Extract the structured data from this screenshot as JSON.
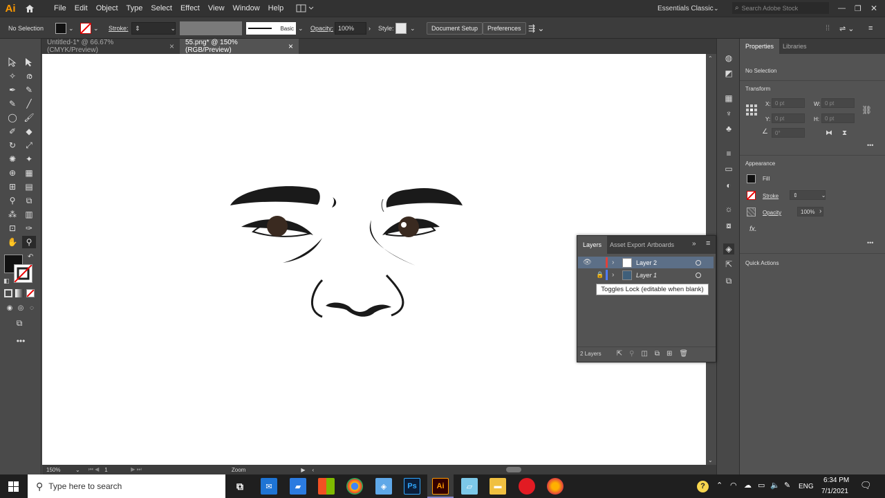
{
  "app": {
    "logo": "Ai"
  },
  "menu": [
    "File",
    "Edit",
    "Object",
    "Type",
    "Select",
    "Effect",
    "View",
    "Window",
    "Help"
  ],
  "workspace": "Essentials Classic",
  "search_placeholder": "Search Adobe Stock",
  "control": {
    "selection": "No Selection",
    "stroke_label": "Stroke:",
    "brush": "Basic",
    "opacity_label": "Opacity:",
    "opacity_value": "100%",
    "style_label": "Style:",
    "doc_setup": "Document Setup",
    "preferences": "Preferences"
  },
  "tabs": [
    {
      "label": "Untitled-1* @ 66.67% (CMYK/Preview)",
      "close": "×"
    },
    {
      "label": "55.png* @ 150% (RGB/Preview)",
      "close": "×"
    }
  ],
  "status": {
    "zoom": "150%",
    "page": "1",
    "tool": "Zoom"
  },
  "properties": {
    "tabs": [
      "Properties",
      "Libraries"
    ],
    "selection": "No Selection",
    "transform": "Transform",
    "x_label": "X:",
    "y_label": "Y:",
    "w_label": "W:",
    "h_label": "H:",
    "pt": "0 pt",
    "angle": "0°",
    "appearance": "Appearance",
    "fill": "Fill",
    "stroke": "Stroke",
    "opacity": "Opacity",
    "opacity_value": "100%",
    "fx": "fx.",
    "quick_actions": "Quick Actions",
    "more": "•••"
  },
  "layers_panel": {
    "tabs": [
      "Layers",
      "Asset Export",
      "Artboards"
    ],
    "layers": [
      {
        "name": "Layer 2",
        "color": "#e0413a"
      },
      {
        "name": "Layer 1",
        "color": "#4f7cff"
      }
    ],
    "count": "2 Layers",
    "tooltip": "Toggles Lock (editable when blank)"
  },
  "taskbar": {
    "search": "Type here to search",
    "lang": "ENG",
    "time": "6:34 PM",
    "date": "7/1/2021"
  },
  "colors": {
    "accent": "#ff9a00",
    "canvas": "#ffffff",
    "ui": "#535353"
  }
}
